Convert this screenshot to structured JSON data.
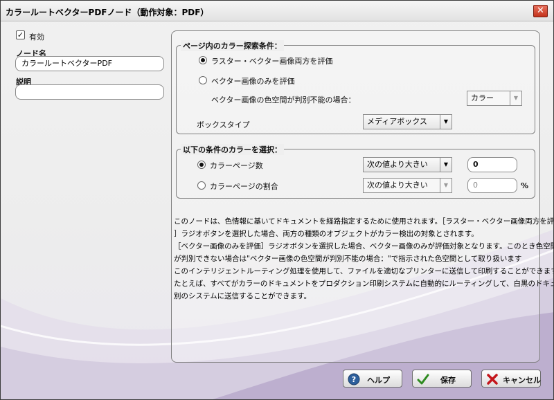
{
  "window": {
    "title": "カラールートベクターPDFノード（動作対象：PDF）",
    "close_glyph": "✕"
  },
  "left": {
    "enabled_label": "有効",
    "enabled_checked": true,
    "node_name_label": "ノード名",
    "node_name_value": "カラールートベクターPDF",
    "description_label": "説明",
    "description_value": ""
  },
  "search_group": {
    "legend": "ページ内のカラー探索条件：",
    "option_both": "ラスター・ベクター画像両方を評価",
    "option_both_checked": true,
    "option_vector": "ベクター画像のみを評価",
    "option_vector_checked": false,
    "undetermined_label": "ベクター画像の色空間が判別不能の場合：",
    "undetermined_value": "カラー",
    "box_type_label": "ボックスタイプ",
    "box_type_value": "メディアボックス"
  },
  "select_group": {
    "legend": "以下の条件のカラーを選択：",
    "pages_label": "カラーページ数",
    "pages_checked": true,
    "pages_operator": "次の値より大きい",
    "pages_value": "0",
    "ratio_label": "カラーページの割合",
    "ratio_checked": false,
    "ratio_operator": "次の値より大きい",
    "ratio_value": "0",
    "ratio_unit": "%"
  },
  "description_lines": [
    "このノードは、色情報に基いてドキュメントを経路指定するために使用されます。［ラスター・ベクター画像両方を評価",
    "］ラジオボタンを選択した場合、両方の種類のオブジェクトがカラー検出の対象とされます。",
    "［ベクター画像のみを評価］ラジオボタンを選択した場合、ベクター画像のみが評価対象となります。このとき色空間",
    "が判別できない場合は\"ベクター画像の色空間が判別不能の場合：\"で指示された色空間として取り扱います",
    "このインテリジェントルーティング処理を使用して、ファイルを適切なプリンターに送信して印刷することができます。",
    "たとえば、すべてがカラーのドキュメントをプロダクション印刷システムに自動的にルーティングして、白黒のドキュメントは",
    "別のシステムに送信することができます。"
  ],
  "buttons": {
    "help": "ヘルプ",
    "save": "保存",
    "cancel": "キャンセル"
  },
  "colors": {
    "accent_purple": "#5c4a86",
    "save_green": "#2e8b1f",
    "cancel_red": "#c4161c",
    "help_blue": "#2d5f9c"
  }
}
